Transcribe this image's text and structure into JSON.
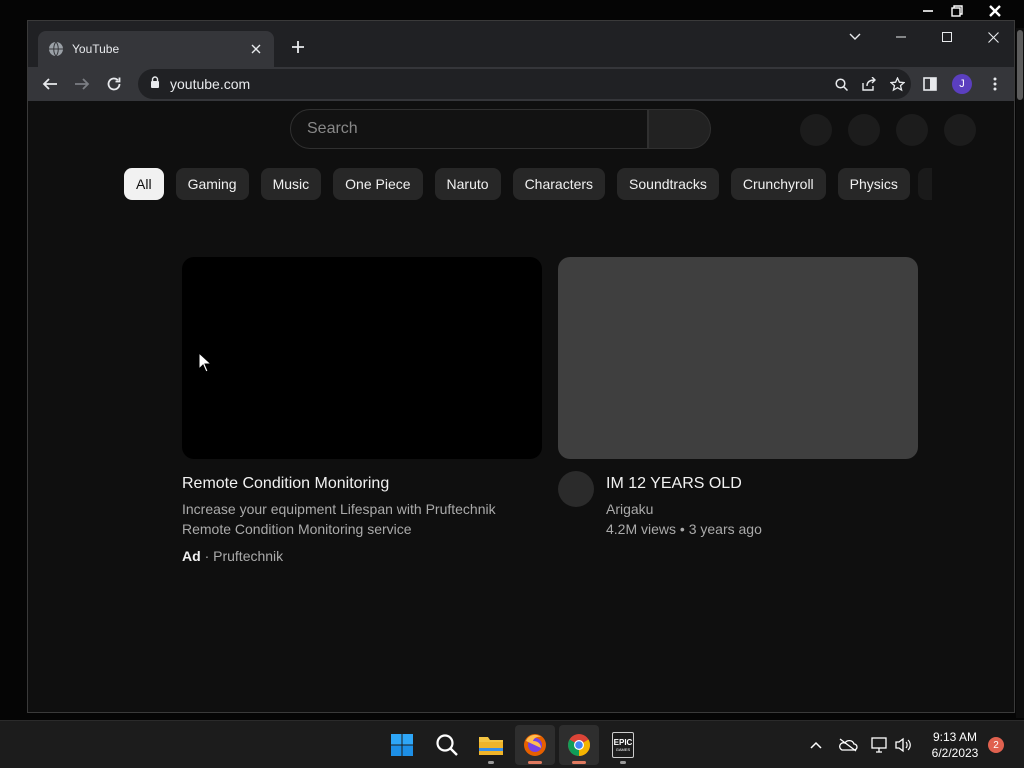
{
  "browser": {
    "tab_title": "YouTube",
    "url": "youtube.com",
    "profile_initial": "J"
  },
  "youtube": {
    "search_placeholder": "Search",
    "chips": [
      "All",
      "Gaming",
      "Music",
      "One Piece",
      "Naruto",
      "Characters",
      "Soundtracks",
      "Crunchyroll",
      "Physics"
    ],
    "active_chip": "All",
    "ad_video": {
      "title": "Remote Condition Monitoring",
      "description_line1": "Increase your equipment Lifespan with Pruftechnik",
      "description_line2": "Remote Condition Monitoring service",
      "ad_label": "Ad",
      "advertiser": "Pruftechnik"
    },
    "video": {
      "title": "IM 12 YEARS OLD",
      "channel": "Arigaku",
      "meta": "4.2M views • 3 years ago"
    }
  },
  "taskbar": {
    "time": "9:13 AM",
    "date": "6/2/2023",
    "notification_count": "2",
    "epic_label_line1": "EPIC",
    "epic_label_line2": "GAMES"
  },
  "colors": {
    "page_bg": "#0f0f0f",
    "chip_bg": "#272727",
    "chip_active_bg": "#f1f1f1",
    "tab_bg": "#35363a",
    "taskbar_bg": "#1c1c1c"
  }
}
